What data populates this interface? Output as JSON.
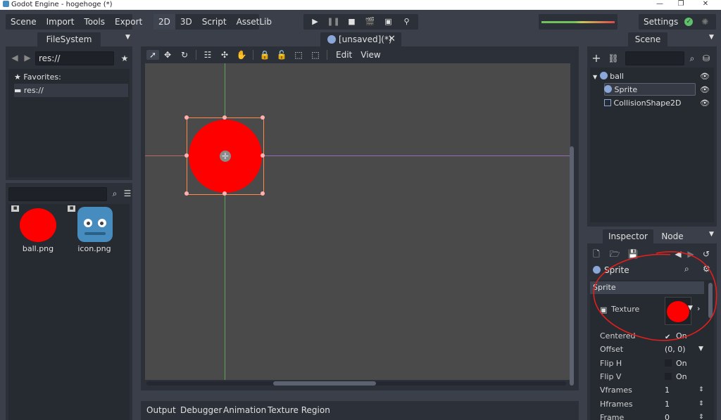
{
  "window": {
    "title": "Godot Engine - hogehoge (*)"
  },
  "menu": {
    "scene": "Scene",
    "import": "Import",
    "tools": "Tools",
    "export": "Export"
  },
  "modes": {
    "d2": "2D",
    "d3": "3D",
    "script": "Script",
    "assetlib": "AssetLib"
  },
  "settings_label": "Settings",
  "scene_tab": {
    "label": "[unsaved](*)"
  },
  "filesystem": {
    "header": "FileSystem",
    "path": "res://",
    "favorites": "Favorites:",
    "res_item": "res://",
    "files": [
      {
        "name": "ball.png"
      },
      {
        "name": "icon.png"
      }
    ]
  },
  "viewport_menu": {
    "edit": "Edit",
    "view": "View"
  },
  "bottom_tabs": [
    "Output",
    "Debugger",
    "Animation",
    "Texture Region"
  ],
  "scene_panel": {
    "header": "Scene",
    "nodes": [
      "ball",
      "Sprite",
      "CollisionShape2D"
    ]
  },
  "inspector": {
    "tab_inspector": "Inspector",
    "tab_node": "Node",
    "object_name": "Sprite",
    "section": "Sprite",
    "texture_label": "Texture",
    "props": [
      {
        "label": "Centered",
        "value": "On",
        "checked": true
      },
      {
        "label": "Offset",
        "value": "(0, 0)"
      },
      {
        "label": "Flip H",
        "value": "On",
        "checked": false
      },
      {
        "label": "Flip V",
        "value": "On",
        "checked": false
      },
      {
        "label": "Vframes",
        "value": "1"
      },
      {
        "label": "Hframes",
        "value": "1"
      },
      {
        "label": "Frame",
        "value": "0"
      }
    ]
  },
  "colors": {
    "accent": "#478cbf",
    "selection": "#ff8a4a",
    "ball": "#ff0000",
    "annotation": "#e0201c"
  }
}
